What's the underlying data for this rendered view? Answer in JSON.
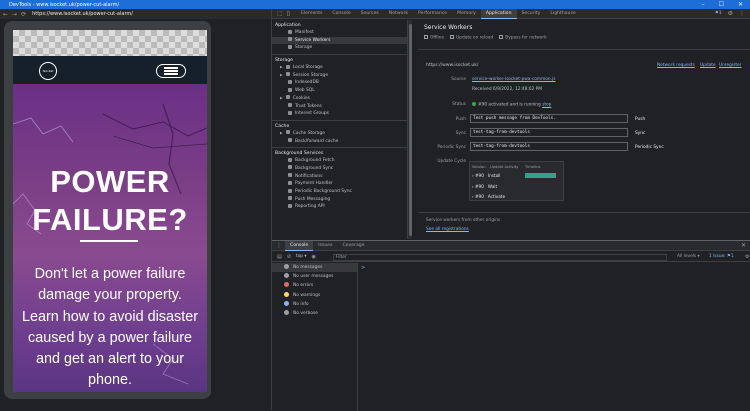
{
  "window": {
    "title": "DevTools - www.isocket.uk/power-cut-alarm/",
    "controls": [
      "–",
      "☐",
      "✕"
    ]
  },
  "browser": {
    "url": "https://www.isocket.uk/power-cut-alarm/"
  },
  "site": {
    "logo_text": "iSocket",
    "hero_title_1": "POWER",
    "hero_title_2": "FAILURE?",
    "hero_body": "Don't let a power failure damage your property. Learn how to avoid disaster caused by a power failure and get an alert to your phone."
  },
  "devtools": {
    "tabs": [
      "Elements",
      "Console",
      "Sources",
      "Network",
      "Performance",
      "Memory",
      "Application",
      "Security",
      "Lighthouse"
    ],
    "active_tab": "Application",
    "issues_badge": "1",
    "sidebar": {
      "application_header": "Application",
      "application_items": [
        "Manifest",
        "Service Workers",
        "Storage"
      ],
      "storage_header": "Storage",
      "storage_items": [
        "Local Storage",
        "Session Storage",
        "IndexedDB",
        "Web SQL",
        "Cookies",
        "Trust Tokens",
        "Interest Groups"
      ],
      "cache_header": "Cache",
      "cache_items": [
        "Cache Storage",
        "Back/forward cache"
      ],
      "bg_header": "Background Services",
      "bg_items": [
        "Background Fetch",
        "Background Sync",
        "Notifications",
        "Payment Handler",
        "Periodic Background Sync",
        "Push Messaging",
        "Reporting API"
      ]
    },
    "service_workers": {
      "title": "Service Workers",
      "opt_offline": "Offline",
      "opt_update_reload": "Update on reload",
      "opt_bypass": "Bypass for network",
      "origin": "https://www.isocket.uk/",
      "link_network": "Network requests",
      "link_update": "Update",
      "link_unregister": "Unregister",
      "source_label": "Source",
      "source_link": "service-worker-isocket-pwa-common.js",
      "received": "Received 6/9/2022, 12:48:02 PM",
      "status_label": "Status",
      "status_text": "#90 activated and is running",
      "status_stop": "stop",
      "push_label": "Push",
      "push_value": "Test push message from DevTools.",
      "push_btn": "Push",
      "sync_label": "Sync",
      "sync_value": "test-tag-from-devtools",
      "sync_btn": "Sync",
      "psync_label": "Periodic Sync",
      "psync_value": "test-tag-from-devtools",
      "psync_btn": "Periodic Sync",
      "uc_label": "Update Cycle",
      "uc_head_version": "Version",
      "uc_head_activity": "Update Activity",
      "uc_head_timeline": "Timeline",
      "uc_rows": [
        {
          "version": "#90",
          "activity": "Install"
        },
        {
          "version": "#90",
          "activity": "Wait"
        },
        {
          "version": "#90",
          "activity": "Activate"
        }
      ],
      "other_origins": "Service workers from other origins",
      "see_all": "See all registrations"
    },
    "drawer": {
      "tabs": [
        "Console",
        "Issues",
        "Coverage"
      ],
      "context": "top",
      "filter_placeholder": "Filter",
      "levels": "All levels",
      "issue_count": "1 Issue",
      "issue_badge": "1",
      "prompt": ">",
      "side_items": [
        {
          "label": "No messages",
          "color": "#9aa0a6"
        },
        {
          "label": "No user messages",
          "color": "#9aa0a6"
        },
        {
          "label": "No errors",
          "color": "#e46962"
        },
        {
          "label": "No warnings",
          "color": "#fdd663"
        },
        {
          "label": "No info",
          "color": "#8ab4f8"
        },
        {
          "label": "No verbose",
          "color": "#9aa0a6"
        }
      ]
    }
  }
}
